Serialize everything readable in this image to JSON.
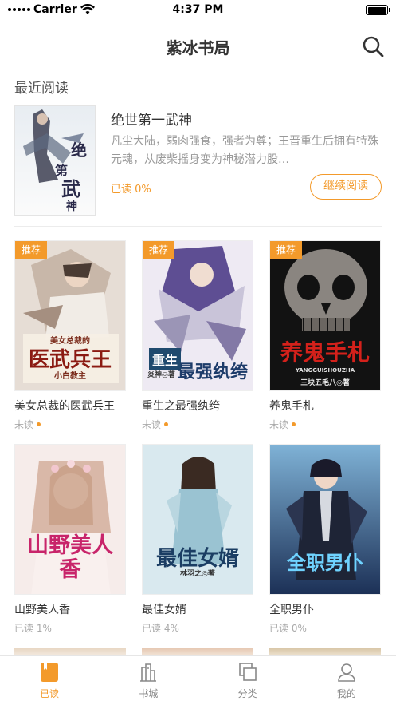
{
  "status_bar": {
    "carrier": "Carrier",
    "time": "4:37 PM"
  },
  "nav": {
    "title": "紫冰书局"
  },
  "recent": {
    "section_title": "最近阅读",
    "book": {
      "title": "绝世第一武神",
      "description": "凡尘大陆，弱肉强食，强者为尊；王晋重生后拥有特殊元魂，从废柴摇身变为神秘潜力股…",
      "progress": "已读 0%",
      "continue_label": "继续阅读",
      "cover_text": "绝世第一武神"
    }
  },
  "books": [
    {
      "title": "美女总裁的医武兵王",
      "status": "未读",
      "badge": "推荐",
      "unread": true,
      "cover_text": "医武兵王",
      "cover_sub": "美女总裁的",
      "author_mark": "小白教主",
      "colors": [
        "#d9cfc7",
        "#b9a89c"
      ]
    },
    {
      "title": "重生之最强纨绔",
      "status": "未读",
      "badge": "推荐",
      "unread": true,
      "cover_text": "最强纨绔",
      "cover_sub": "重生",
      "author_mark": "炎神◎著",
      "colors": [
        "#e9e4ef",
        "#8a7fb0"
      ]
    },
    {
      "title": "养鬼手札",
      "status": "未读",
      "badge": "推荐",
      "unread": true,
      "cover_text": "养鬼手札",
      "cover_sub": "YANGGUISHOUZHA",
      "author_mark": "三块五毛八◎著",
      "colors": [
        "#3a3a3a",
        "#0d0d0d"
      ]
    },
    {
      "title": "山野美人香",
      "status": "已读 1%",
      "badge": "",
      "unread": false,
      "cover_text": "山野美人香",
      "cover_sub": "",
      "author_mark": "",
      "colors": [
        "#f4e7e6",
        "#e0c3c3"
      ]
    },
    {
      "title": "最佳女婿",
      "status": "已读 4%",
      "badge": "",
      "unread": false,
      "cover_text": "最佳女婿",
      "cover_sub": "",
      "author_mark": "林羽之◎著",
      "colors": [
        "#cfe3ec",
        "#7aa6bb"
      ]
    },
    {
      "title": "全职男仆",
      "status": "已读 0%",
      "badge": "",
      "unread": false,
      "cover_text": "全职男仆",
      "cover_sub": "",
      "author_mark": "",
      "colors": [
        "#5d8fb8",
        "#1f3a63"
      ]
    }
  ],
  "tabs": [
    {
      "label": "已读",
      "icon": "book-icon",
      "active": true
    },
    {
      "label": "书城",
      "icon": "bookstore-icon",
      "active": false
    },
    {
      "label": "分类",
      "icon": "category-icon",
      "active": false
    },
    {
      "label": "我的",
      "icon": "profile-icon",
      "active": false
    }
  ],
  "colors": {
    "accent": "#f39a2b",
    "text": "#333333",
    "muted": "#999999"
  }
}
